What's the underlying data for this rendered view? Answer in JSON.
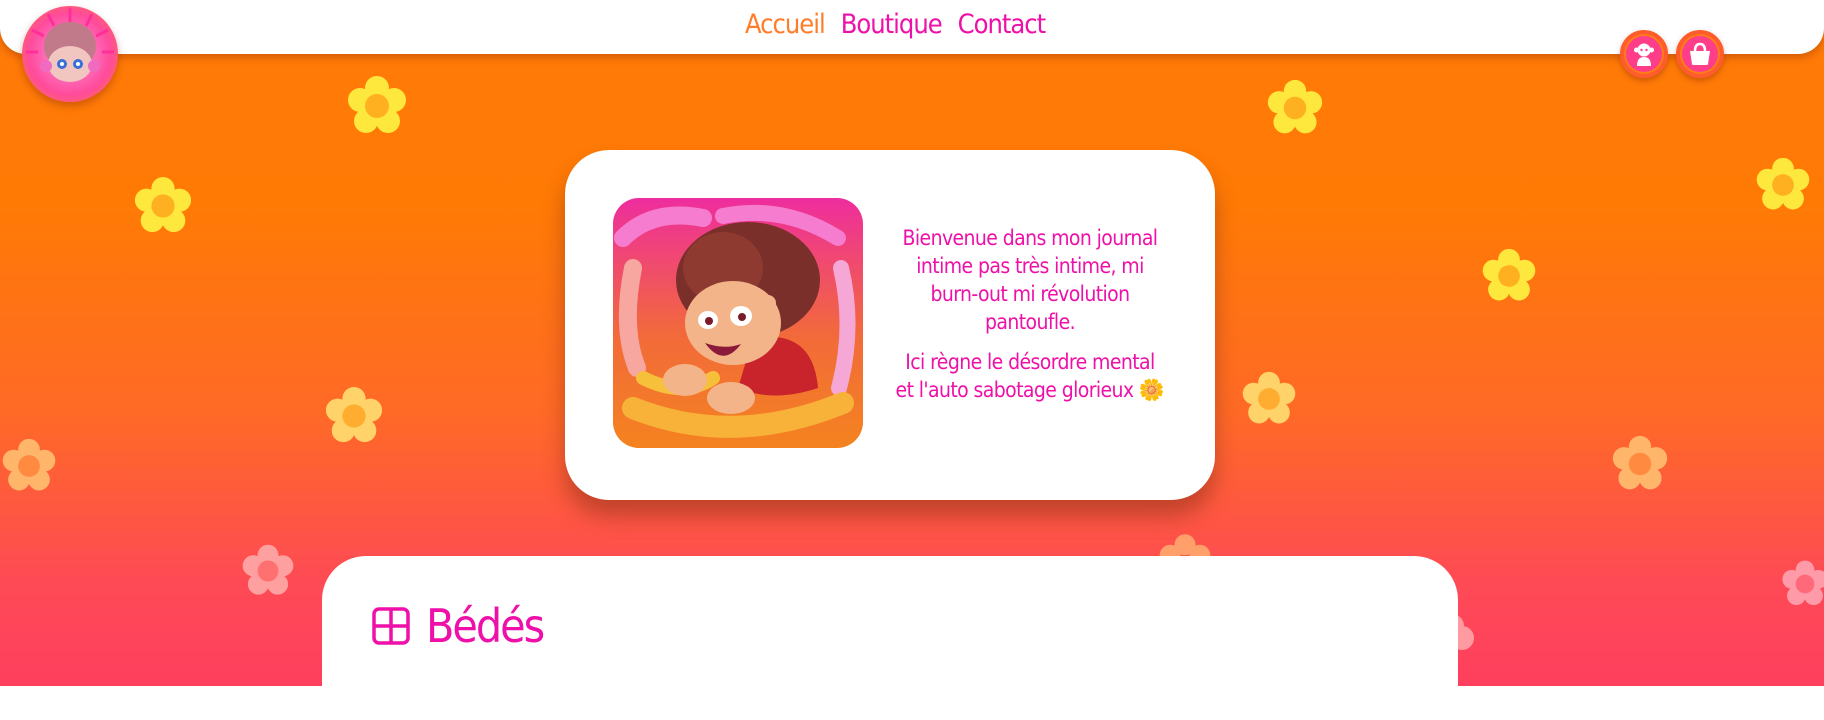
{
  "nav": {
    "items": [
      {
        "label": "Accueil",
        "active": true
      },
      {
        "label": "Boutique",
        "active": false
      },
      {
        "label": "Contact",
        "active": false
      }
    ]
  },
  "header": {
    "logo_icon": "avatar-logo-icon",
    "account_icon": "account-icon",
    "cart_icon": "shopping-bag-icon"
  },
  "intro": {
    "paragraph_1": "Bienvenue dans mon journal intime pas très intime, mi burn-out mi révolution pantoufle.",
    "paragraph_2": "Ici règne le désordre mental et l'auto sabotage glorieux 🌼",
    "artwork_icon": "artwork-illustration"
  },
  "section": {
    "title": "Bédés",
    "icon": "grid-icon"
  },
  "colors": {
    "accent_pink": "#ee10a8",
    "active_orange": "#ff7d2a",
    "bg_top": "#ff7a08",
    "bg_bottom": "#fe3f5e",
    "flower_yellow": "#fff24a"
  }
}
